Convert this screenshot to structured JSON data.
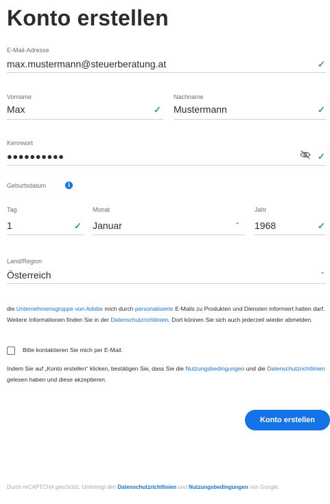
{
  "page": {
    "title": "Konto erstellen"
  },
  "email": {
    "label": "E-Mail-Adresse",
    "value": "max.mustermann@steuerberatung.at"
  },
  "first_name": {
    "label": "Vorname",
    "value": "Max"
  },
  "last_name": {
    "label": "Nachname",
    "value": "Mustermann"
  },
  "password": {
    "label": "Kennwort",
    "value": "●●●●●●●●●●"
  },
  "birthdate": {
    "label": "Geburtsdatum",
    "day": {
      "label": "Tag",
      "value": "1"
    },
    "month": {
      "label": "Monat",
      "value": "Januar"
    },
    "year": {
      "label": "Jahr",
      "value": "1968"
    }
  },
  "country": {
    "label": "Land/Region",
    "value": "Österreich"
  },
  "consent": {
    "t1": "die ",
    "link1": "Unternehmensgruppe von Adobe",
    "t2": " mich durch ",
    "link2": "personalisierte",
    "t3": " E-Mails zu Produkten und Diensten informiert halten darf. Weitere Informationen finden Sie in der ",
    "link3": "Datenschutzrichtlinien",
    "t4": ". Dort können Sie sich auch jederzeit wieder abmelden."
  },
  "contact_checkbox": {
    "label": "Bitte kontaktieren Sie mich per E-Mail."
  },
  "terms": {
    "t1": "Indem Sie auf „Konto erstellen“ klicken, bestätigen Sie, dass Sie die ",
    "link1": "Nutzungsbedingungen",
    "t2": " und die ",
    "link2": "Datenschutzrichtlinien",
    "t3": " gelesen haben und diese akzeptieren."
  },
  "submit": {
    "label": "Konto erstellen"
  },
  "footer": {
    "t1": "Durch reCAPTCHA geschützt. Unterliegt den ",
    "link1": "Datenschutzrichtlinien",
    "t2": " und ",
    "link2": "Nutzungsbedingungen",
    "t3": " von Google."
  },
  "icons": {
    "check": "✓",
    "chevron": "⌄",
    "eye_off": "eye-off",
    "info": "i"
  },
  "colors": {
    "accent": "#1473e6",
    "valid": "#2d9d78",
    "text": "#2c2c2c"
  }
}
